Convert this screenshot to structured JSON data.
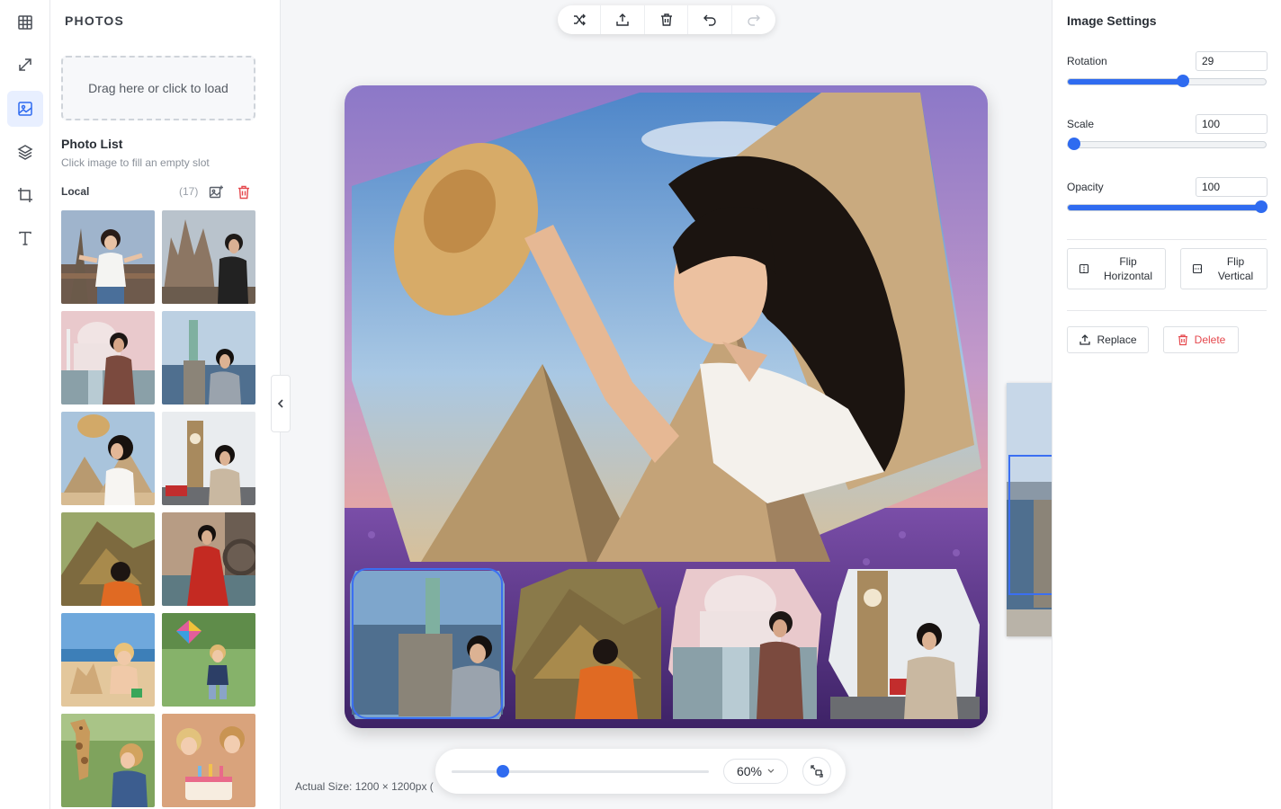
{
  "sidebar_rail": {
    "items": [
      {
        "icon": "grid-icon"
      },
      {
        "icon": "resize-icon"
      },
      {
        "icon": "photo-icon",
        "active": true
      },
      {
        "icon": "layers-icon"
      },
      {
        "icon": "crop-icon"
      },
      {
        "icon": "text-icon"
      }
    ]
  },
  "photos_panel": {
    "title": "PHOTOS",
    "dropzone_text": "Drag here or click to load",
    "list_title": "Photo List",
    "list_hint": "Click image to fill an empty slot",
    "local_label": "Local",
    "local_count": "(17)",
    "thumbnails": [
      "eiffel-tower-woman",
      "sagrada-familia-woman",
      "taj-mahal-woman",
      "statue-of-liberty-woman",
      "pyramids-hat-woman",
      "big-ben-woman",
      "machu-picchu-woman",
      "venice-red-dress-woman",
      "sandcastle-boy",
      "kite-boy",
      "giraffe-boy",
      "birthday-cake-kids"
    ]
  },
  "toolbar": {
    "buttons": [
      "shuffle-icon",
      "export-icon",
      "trash-icon",
      "undo-icon",
      "redo-icon"
    ]
  },
  "zoom": {
    "value_label": "60%",
    "level": 0.2,
    "actual_size": "Actual Size: 1200 × 1200px ("
  },
  "settings": {
    "title": "Image Settings",
    "rotation_label": "Rotation",
    "rotation_value": "29",
    "rotation_level": 0.58,
    "scale_label": "Scale",
    "scale_value": "100",
    "scale_level": 0.0,
    "opacity_label": "Opacity",
    "opacity_value": "100",
    "opacity_level": 1.0,
    "flip_h_line1": "Flip",
    "flip_h_line2": "Horizontal",
    "flip_v_line1": "Flip",
    "flip_v_line2": "Vertical",
    "replace_label": "Replace",
    "delete_label": "Delete"
  },
  "colors": {
    "accent": "#2f6bf0",
    "danger": "#e5484d",
    "panel_bg": "#ffffff",
    "app_bg": "#f5f6f8"
  }
}
